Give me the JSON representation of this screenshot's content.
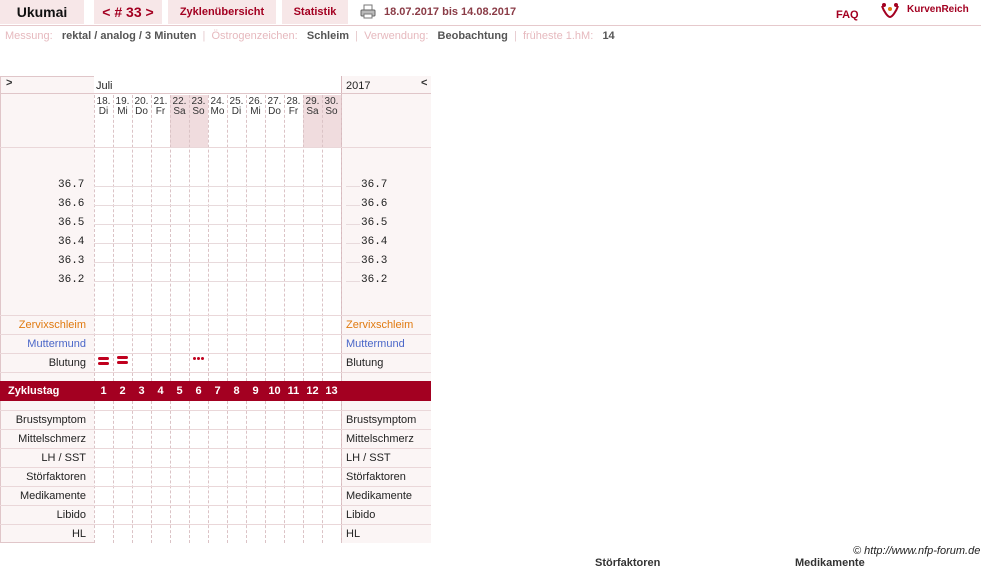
{
  "header": {
    "brand": "Ukumai",
    "cycle": "< # 33 >",
    "tabs": [
      "Zyklenübersicht",
      "Statistik"
    ],
    "date_range": "18.07.2017 bis 14.08.2017",
    "faq": "FAQ",
    "partner": "KurvenReich"
  },
  "info": {
    "messung_label": "Messung:",
    "messung_value": "rektal / analog / 3 Minuten",
    "oestrogen_label": "Östrogenzeichen:",
    "oestrogen_value": "Schleim",
    "verwendung_label": "Verwendung:",
    "verwendung_value": "Beobachtung",
    "hm_label": "früheste 1.hM:",
    "hm_value": "14"
  },
  "chart": {
    "left_arrow": ">",
    "right_arrow": "<",
    "month": "Juli",
    "year": "2017",
    "days": [
      {
        "d": "18.",
        "w": "Di"
      },
      {
        "d": "19.",
        "w": "Mi"
      },
      {
        "d": "20.",
        "w": "Do"
      },
      {
        "d": "21.",
        "w": "Fr"
      },
      {
        "d": "22.",
        "w": "Sa"
      },
      {
        "d": "23.",
        "w": "So"
      },
      {
        "d": "24.",
        "w": "Mo"
      },
      {
        "d": "25.",
        "w": "Di"
      },
      {
        "d": "26.",
        "w": "Mi"
      },
      {
        "d": "27.",
        "w": "Do"
      },
      {
        "d": "28.",
        "w": "Fr"
      },
      {
        "d": "29.",
        "w": "Sa"
      },
      {
        "d": "30.",
        "w": "So"
      }
    ],
    "temps": [
      "36.7",
      "36.6",
      "36.5",
      "36.4",
      "36.3",
      "36.2"
    ],
    "rows_top": [
      "Zervixschleim",
      "Muttermund",
      "Blutung"
    ],
    "zyklustag_label": "Zyklustag",
    "zyklustag": [
      "1",
      "2",
      "3",
      "4",
      "5",
      "6",
      "7",
      "8",
      "9",
      "10",
      "11",
      "12",
      "13"
    ],
    "rows_bottom": [
      "Brustsymptom",
      "Mittelschmerz",
      "LH / SST",
      "Störfaktoren",
      "Medikamente",
      "Libido",
      "HL"
    ]
  },
  "footer": {
    "copyright": "© http://www.nfp-forum.de",
    "cut1": "Störfaktoren",
    "cut2": "Medikamente"
  },
  "colors": {
    "accent": "#a30021",
    "zervix": "#e07a10",
    "muttermund": "#4a66c8"
  }
}
